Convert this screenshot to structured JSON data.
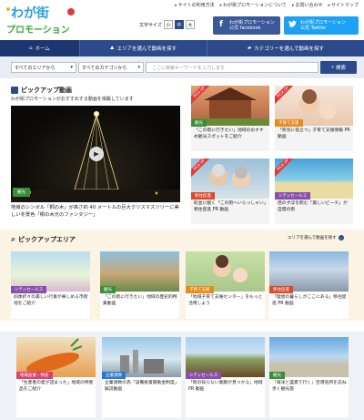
{
  "header": {
    "logo_line1": "わが街",
    "logo_line2": "プロモーション",
    "top_links": [
      "サイトの利用方法",
      "わが街プロモーションについて",
      "お問い合わせ",
      "サイトマップ"
    ],
    "font_size_label": "文字サイズ",
    "font_sizes": [
      "小",
      "中",
      "大"
    ],
    "facebook": {
      "line1": "わが街プロモーション",
      "line2": "公式 facebook",
      "icon": "f"
    },
    "twitter": {
      "line1": "わが街プロモーション",
      "line2": "公式 Twitter",
      "icon": "t"
    }
  },
  "nav": {
    "home": "ホーム",
    "area": "エリアを選んで動画を探す",
    "category": "カテゴリーを選んで動画を探す"
  },
  "search": {
    "area_select": "すべてのエリアから",
    "category_select": "すべてのカテゴリから",
    "placeholder": "ここに検索キーワードを入力します",
    "button": "検索"
  },
  "pickup_video": {
    "title": "ピックアップ動画",
    "subtitle": "わが街プロモーションがおすすめする動画を掲載しています",
    "main": {
      "tag": "観光",
      "caption": "地域のシンボル「桐の木」が高さ約 40 メートルの巨大クリスマスツリーに美しい冬景色「桐の木光のファンタジー」"
    },
    "ribbon": "PICK UP",
    "cards": [
      {
        "tag": "観光",
        "text": "「この街に行きたい」地域のおすすめ観光スポットをご紹介"
      },
      {
        "tag": "子育て支援",
        "text": "「育児に役立つ」子育て支援情報 PR 動画"
      },
      {
        "tag": "移住促進",
        "text": "町並に魅く「この街へいらっしゃい」移住促進 PR 動画"
      },
      {
        "tag": "シティセールス",
        "text": "芭のずぼを飲む「美しいビーチ」が自慢の街"
      }
    ]
  },
  "pickup_area": {
    "title": "ピックアップエリア",
    "more": "エリアを選んで動画を探す",
    "cards": [
      {
        "tag": "シティセールス",
        "text": "四季折々の美しい行事が楽しめる市街地をご紹介"
      },
      {
        "tag": "観光",
        "text": "「この街に行きたい」地域の歴史的特集動画"
      },
      {
        "tag": "子育て支援",
        "text": "「地域子育て支援センター」をもっと活用しよう"
      },
      {
        "tag": "移住促進",
        "text": "「理想の暮らしがここにある」移住促進 PR 動画"
      }
    ]
  },
  "more_videos": {
    "cards": [
      {
        "tag": "地場産業・物産",
        "text": "「生産者の愛が詰まった」地域の特産品をご紹介"
      },
      {
        "tag": "企業誘致",
        "text": "企業誘致の為「設備投資補助金制度」解説動画"
      },
      {
        "tag": "シティセールス",
        "text": "「街の知らない素敵が見つかる」地域 PR 動画"
      },
      {
        "tag": "観光",
        "text": "「海洋と盛夏で行く」空港名所を訪ね歩く観光旅"
      }
    ]
  },
  "colors": {
    "navy": "#2c4a8a",
    "tag_green": "#3a8e3a",
    "tag_red": "#d94a2a",
    "tag_orange": "#e8891a",
    "tag_purple": "#8a4fae",
    "tag_pink": "#d9436f",
    "tag_blue": "#2a79c9",
    "tag_yellow": "#e7a51a"
  }
}
